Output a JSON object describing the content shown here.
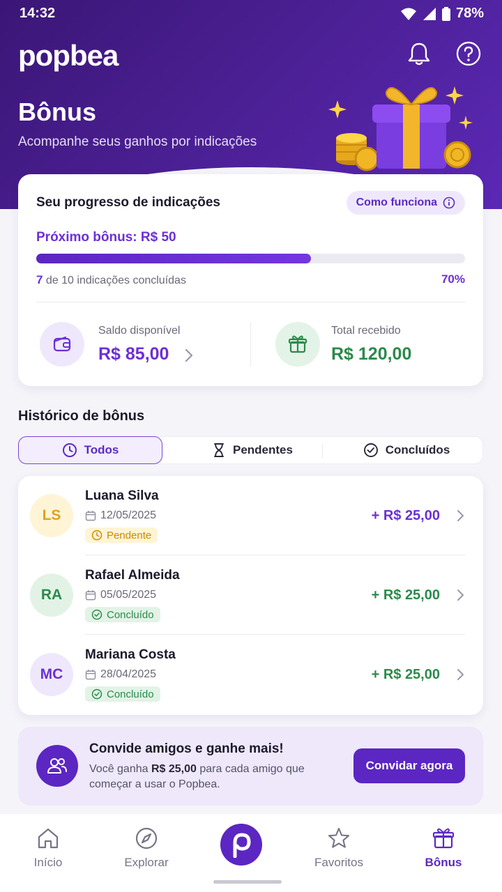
{
  "status_bar": {
    "time": "14:32",
    "battery": "78%"
  },
  "header": {
    "logo": "popbea",
    "title": "Bônus",
    "subtitle": "Acompanhe seus ganhos por indicações"
  },
  "progress": {
    "title": "Seu progresso de indicações",
    "how_it_works": "Como funciona",
    "next_bonus": "Próximo bônus: R$ 50",
    "completed_count": "7",
    "count_text": " de 10 indicações concluídas",
    "percent": "70%",
    "fraction": 0.64,
    "balance_label": "Saldo disponível",
    "balance_value": "R$ 85,00",
    "total_label": "Total recebido",
    "total_value": "R$ 120,00"
  },
  "history": {
    "title": "Histórico de bônus",
    "tabs": [
      {
        "label": "Todos",
        "icon": "clock-icon",
        "active": true
      },
      {
        "label": "Pendentes",
        "icon": "hourglass-icon",
        "active": false
      },
      {
        "label": "Concluídos",
        "icon": "check-circle-icon",
        "active": false
      }
    ],
    "items": [
      {
        "initials": "LS",
        "name": "Luana Silva",
        "date": "12/05/2025",
        "status": "Pendente",
        "amount": "+ R$ 25,00"
      },
      {
        "initials": "RA",
        "name": "Rafael Almeida",
        "date": "05/05/2025",
        "status": "Concluído",
        "amount": "+ R$ 25,00"
      },
      {
        "initials": "MC",
        "name": "Mariana Costa",
        "date": "28/04/2025",
        "status": "Concluído",
        "amount": "+ R$ 25,00"
      }
    ]
  },
  "invite": {
    "title": "Convide amigos e ganhe mais!",
    "text_prefix": "Você ganha ",
    "text_amount": "R$ 25,00",
    "text_suffix": " para cada amigo que começar a usar o Popbea.",
    "button": "Convidar agora"
  },
  "nav": {
    "items": [
      {
        "label": "Início",
        "icon": "home-icon"
      },
      {
        "label": "Explorar",
        "icon": "compass-icon"
      },
      {
        "label": "Favoritos",
        "icon": "star-icon"
      },
      {
        "label": "Bônus",
        "icon": "gift-icon",
        "active": true
      }
    ]
  },
  "colors": {
    "brand": "#5b26c2",
    "accent": "#6d2fd6",
    "success": "#2b8a4b",
    "pending": "#c98a00"
  }
}
